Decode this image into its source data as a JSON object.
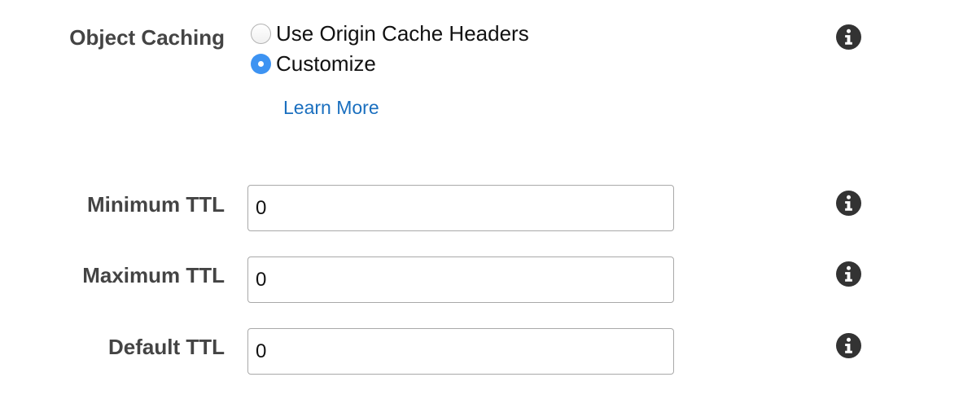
{
  "object_caching": {
    "label": "Object Caching",
    "options": [
      {
        "label": "Use Origin Cache Headers",
        "selected": false
      },
      {
        "label": "Customize",
        "selected": true
      }
    ],
    "learn_more": "Learn More",
    "info_icon": "info-circle-icon"
  },
  "minimum_ttl": {
    "label": "Minimum TTL",
    "value": "0",
    "info_icon": "info-circle-icon"
  },
  "maximum_ttl": {
    "label": "Maximum TTL",
    "value": "0",
    "info_icon": "info-circle-icon"
  },
  "default_ttl": {
    "label": "Default TTL",
    "value": "0",
    "info_icon": "info-circle-icon"
  },
  "colors": {
    "label_text": "#444444",
    "link": "#1a6fbf",
    "radio_selected": "#3d93f2",
    "input_border": "#a9a9a9",
    "info_icon": "#333333"
  }
}
